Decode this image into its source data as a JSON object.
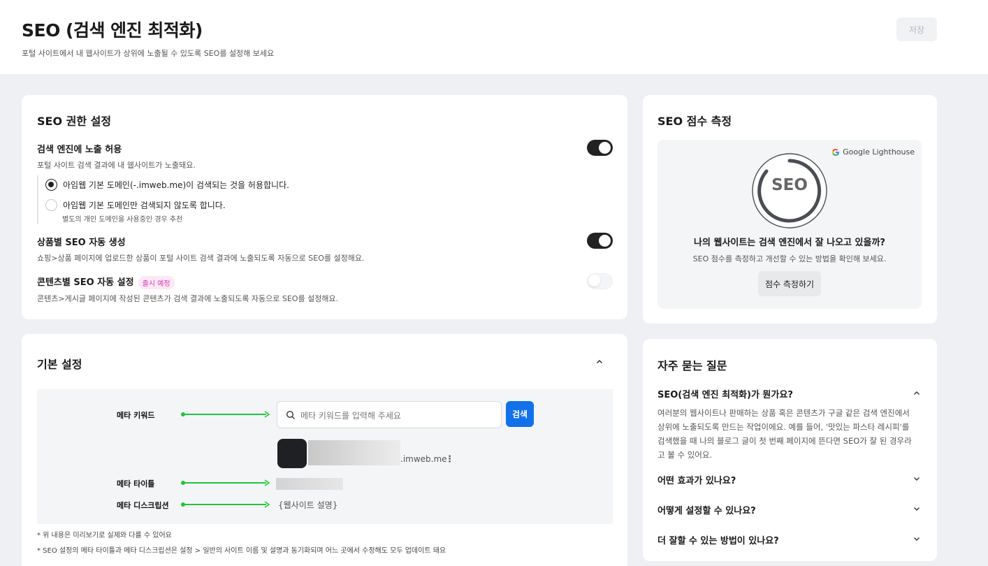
{
  "header": {
    "title": "SEO (검색 엔진 최적화)",
    "subtitle": "포털 사이트에서 내 웹사이트가 상위에 노출될 수 있도록 SEO를 설정해 보세요",
    "save_label": "저장"
  },
  "permissions": {
    "title": "SEO 권한 설정",
    "search_exposure": {
      "title": "검색 엔진에 노출 허용",
      "desc": "포털 사이트 검색 결과에 내 웹사이트가 노출돼요.",
      "enabled": true,
      "options": [
        {
          "label": "아임웹 기본 도메인(-.imweb.me)이 검색되는 것을 허용합니다.",
          "checked": true
        },
        {
          "label": "아임웹 기본 도메인만 검색되지 않도록 합니다.",
          "checked": false
        }
      ],
      "option_note": "별도의 개인 도메인을 사용중인 경우 추천"
    },
    "product_seo": {
      "title": "상품별 SEO 자동 생성",
      "desc": "쇼핑>상품 페이지에 업로드한 상품이 포털 사이트 검색 결과에 노출되도록 자동으로 SEO를 설정해요.",
      "enabled": true
    },
    "content_seo": {
      "title": "콘텐츠별 SEO 자동 설정",
      "badge": "출시 예정",
      "desc": "콘텐츠>게시글 페이지에 작성된 콘텐츠가 검색 결과에 노출되도록 자동으로 SEO를 설정해요.",
      "enabled": false
    }
  },
  "basic": {
    "title": "기본 설정",
    "preview": {
      "keyword_label": "메타 키워드",
      "search_placeholder": "메타 키워드를 입력해 주세요",
      "search_button": "검색",
      "domain": ".imweb.me",
      "title_label": "메타 타이틀",
      "desc_label": "메타 디스크립션",
      "desc_value": "{웹사이트 설명}"
    },
    "note1": "* 위 내용은 미리보기로 실제와 다를 수 있어요",
    "note2": "* SEO 설정의 메타 타이틀과 메타 디스크립션은 설정 > 일반의 사이트 이름 및 설명과 동기화되며 어느 곳에서 수정해도 모두 업데이트 돼요"
  },
  "score": {
    "title": "SEO 점수 측정",
    "lighthouse_label": "Google Lighthouse",
    "ring_text": "SEO",
    "question": "나의 웹사이트는 검색 엔진에서 잘 나오고 있을까?",
    "desc": "SEO 점수를 측정하고 개선할 수 있는 방법을 확인해 보세요.",
    "button": "점수 측정하기"
  },
  "faq": {
    "title": "자주 묻는 질문",
    "items": [
      {
        "q": "SEO(검색 엔진 최적화)가 뭔가요?",
        "expanded": true,
        "a": "여러분의 웹사이트나 판매하는 상품 혹은 콘텐츠가 구글 같은 검색 엔진에서 상위에 노출되도록 만드는 작업이에요. 예를 들어, '맛있는 파스타 레시피'를 검색했을 때 나의 블로그 글이 첫 번째 페이지에 뜬다면 SEO가 잘 된 경우라고 볼 수 있어요."
      },
      {
        "q": "어떤 효과가 있나요?",
        "expanded": false
      },
      {
        "q": "어떻게 설정할 수 있나요?",
        "expanded": false
      },
      {
        "q": "더 잘할 수 있는 방법이 있나요?",
        "expanded": false
      }
    ]
  },
  "colors": {
    "accent": "#1271e8",
    "arrow": "#22c33a",
    "badge": "#d33fb3"
  }
}
